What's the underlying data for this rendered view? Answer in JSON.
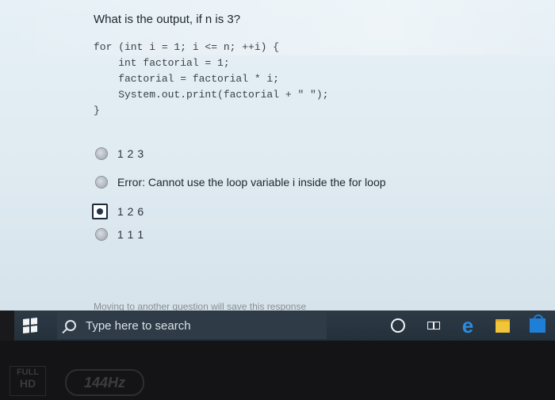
{
  "question": {
    "text": "What is the output, if n is 3?"
  },
  "code": {
    "lines": [
      "for (int i = 1; i <= n; ++i) {",
      "    int factorial = 1;",
      "    factorial = factorial * i;",
      "    System.out.print(factorial + \" \");",
      "}"
    ]
  },
  "options": [
    {
      "label": "1 2 3",
      "selected": false
    },
    {
      "label": "Error: Cannot use the loop variable i inside the for loop",
      "selected": false
    },
    {
      "label": "1 2 6",
      "selected": true
    },
    {
      "label": "1 1 1",
      "selected": false
    }
  ],
  "partial_text": "Moving to another question will save this response",
  "taskbar": {
    "search_placeholder": "Type here to search",
    "icons": [
      "windows-start-icon",
      "search-icon",
      "cortana-icon",
      "task-view-icon",
      "edge-icon",
      "file-explorer-icon",
      "store-icon"
    ]
  },
  "bezel": {
    "badge_top": "FULL",
    "badge_bottom": "HD",
    "refresh": "144Hz"
  },
  "colors": {
    "screen_bg": "#e2edf4",
    "taskbar_bg": "#2a3541",
    "edge_blue": "#2a8ce0",
    "folder_yellow": "#f0c53a"
  }
}
